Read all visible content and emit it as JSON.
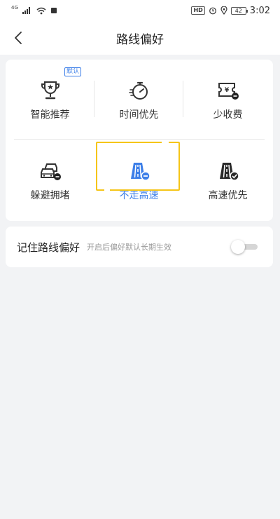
{
  "status_bar": {
    "network": "4G",
    "battery": "42",
    "time": "3:02",
    "hd": "HD"
  },
  "header": {
    "title": "路线偏好",
    "back_icon": "chevron-left-icon"
  },
  "options": [
    {
      "label": "智能推荐",
      "icon": "trophy-icon",
      "badge": "默认",
      "selected": false
    },
    {
      "label": "时间优先",
      "icon": "stopwatch-icon",
      "selected": false
    },
    {
      "label": "少收费",
      "icon": "toll-ticket-icon",
      "selected": false
    },
    {
      "label": "躲避拥堵",
      "icon": "traffic-cars-icon",
      "selected": false
    },
    {
      "label": "不走高速",
      "icon": "no-highway-icon",
      "selected": true
    },
    {
      "label": "高速优先",
      "icon": "highway-check-icon",
      "selected": false
    }
  ],
  "remember": {
    "label": "记住路线偏好",
    "hint": "开启后偏好默认长期生效",
    "enabled": false
  },
  "colors": {
    "accent": "#3d7fe8",
    "selection_frame": "#f5c518",
    "background": "#f2f3f5"
  }
}
